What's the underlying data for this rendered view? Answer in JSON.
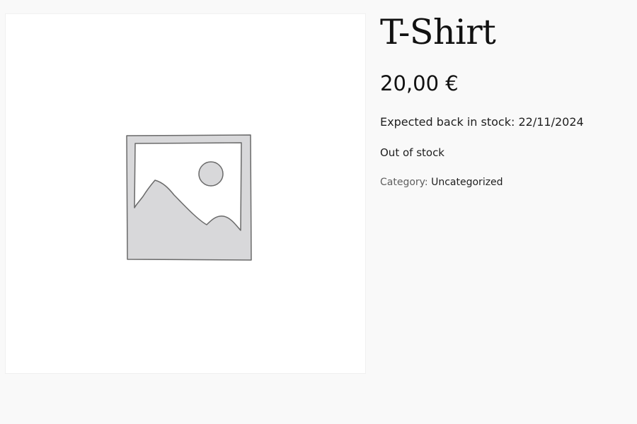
{
  "product": {
    "title": "T-Shirt",
    "price": "20,00 €",
    "backorder_note": "Expected back in stock: 22/11/2024",
    "stock_status": "Out of stock",
    "category_label": "Category:",
    "category_value": "Uncategorized"
  },
  "image": {
    "icon": "image-placeholder-icon"
  },
  "colors": {
    "background": "#f9f9f9",
    "image_bg": "#ffffff",
    "placeholder_fill": "#d8d8da",
    "placeholder_stroke": "#666666"
  }
}
